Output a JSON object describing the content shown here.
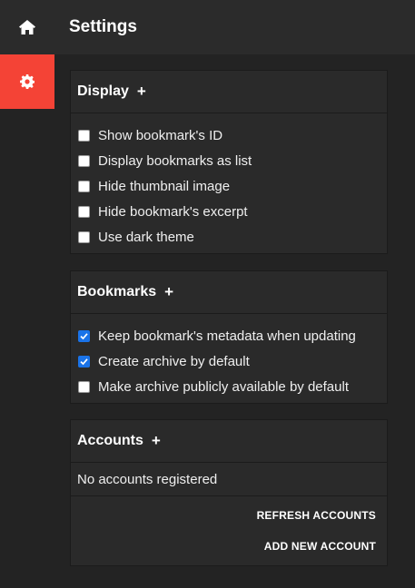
{
  "app": {
    "title": "Settings"
  },
  "sidebar": {
    "items": [
      {
        "icon": "home-icon",
        "active": false
      },
      {
        "icon": "gear-icon",
        "active": true
      }
    ],
    "accent": "#f44336"
  },
  "display": {
    "title": "Display",
    "expand": "+",
    "options": [
      {
        "label": "Show bookmark's ID",
        "checked": false
      },
      {
        "label": "Display bookmarks as list",
        "checked": false
      },
      {
        "label": "Hide thumbnail image",
        "checked": false
      },
      {
        "label": "Hide bookmark's excerpt",
        "checked": false
      },
      {
        "label": "Use dark theme",
        "checked": false
      }
    ]
  },
  "bookmarks": {
    "title": "Bookmarks",
    "expand": "+",
    "options": [
      {
        "label": "Keep bookmark's metadata when updating",
        "checked": true
      },
      {
        "label": "Create archive by default",
        "checked": true
      },
      {
        "label": "Make archive publicly available by default",
        "checked": false
      }
    ]
  },
  "accounts": {
    "title": "Accounts",
    "expand": "+",
    "empty_message": "No accounts registered",
    "refresh_label": "REFRESH ACCOUNTS",
    "add_label": "ADD NEW ACCOUNT"
  }
}
